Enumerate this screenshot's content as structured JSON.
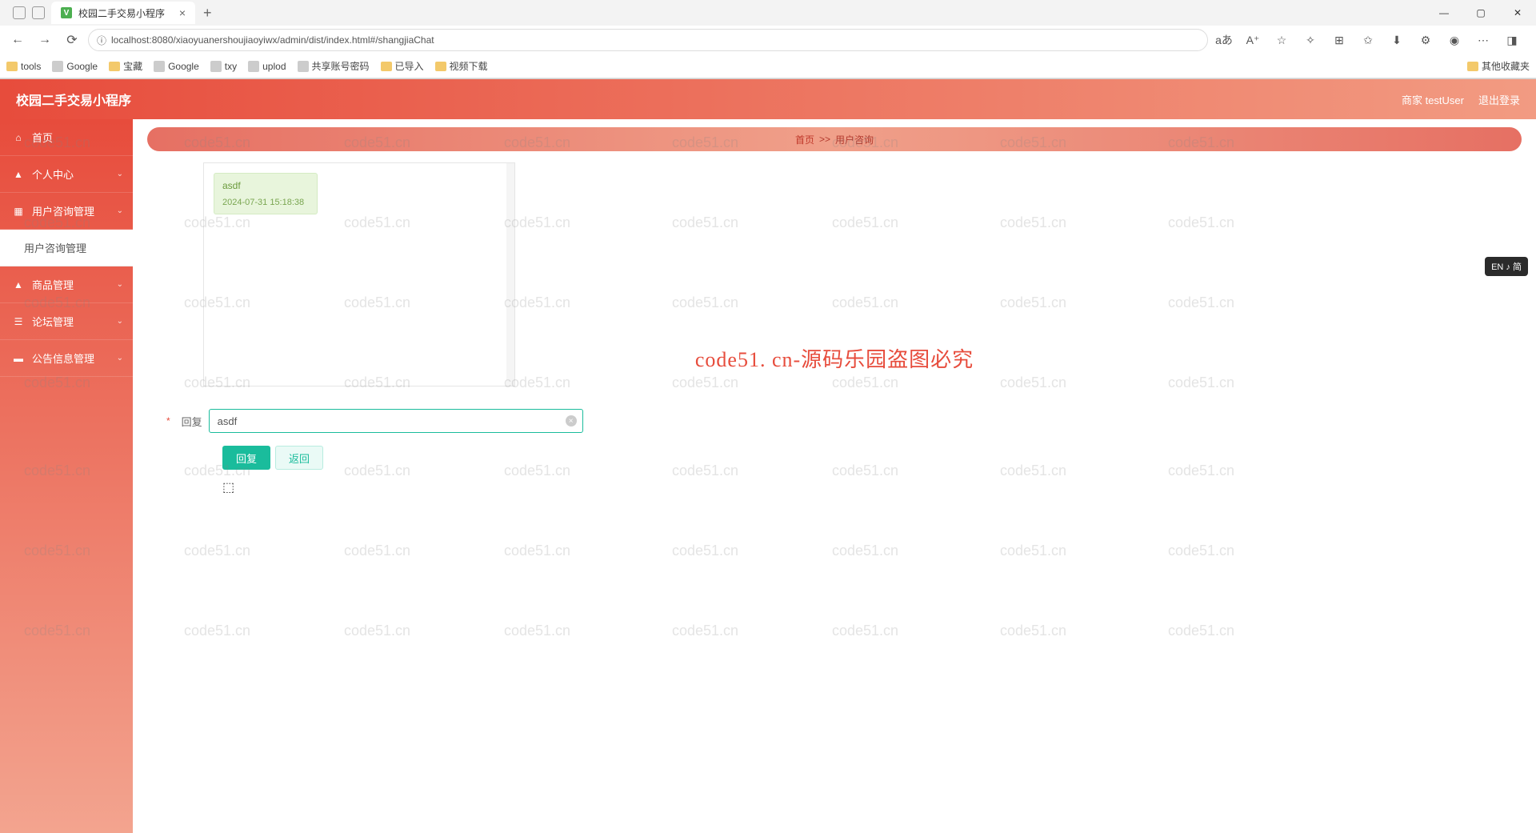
{
  "browser": {
    "tab_title": "校园二手交易小程序",
    "url": "localhost:8080/xiaoyuanershoujiaoyiwx/admin/dist/index.html#/shangjiaChat",
    "bookmarks": [
      "tools",
      "Google",
      "宝藏",
      "Google",
      "txy",
      "uplod",
      "共享账号密码",
      "已导入",
      "视频下载"
    ],
    "bookmark_right": "其他收藏夹"
  },
  "header": {
    "title": "校园二手交易小程序",
    "user_label": "商家 testUser",
    "logout": "退出登录"
  },
  "sidebar": {
    "items": [
      {
        "icon": "⌂",
        "label": "首页",
        "chev": false
      },
      {
        "icon": "▲",
        "label": "个人中心",
        "chev": true
      },
      {
        "icon": "▦",
        "label": "用户咨询管理",
        "chev": true
      },
      {
        "icon": "",
        "label": "用户咨询管理",
        "sub": true
      },
      {
        "icon": "▲",
        "label": "商品管理",
        "chev": true
      },
      {
        "icon": "☰",
        "label": "论坛管理",
        "chev": true
      },
      {
        "icon": "▬",
        "label": "公告信息管理",
        "chev": true
      }
    ]
  },
  "breadcrumb": {
    "home": "首页",
    "sep": ">>",
    "current": "用户咨询"
  },
  "chat": {
    "message_text": "asdf",
    "message_time": "2024-07-31 15:18:38"
  },
  "form": {
    "label": "回复",
    "value": "asdf",
    "submit": "回复",
    "back": "返回"
  },
  "ime": "EN ♪ 简",
  "watermark_text": "code51.cn",
  "watermark_center": "code51. cn-源码乐园盗图必究"
}
